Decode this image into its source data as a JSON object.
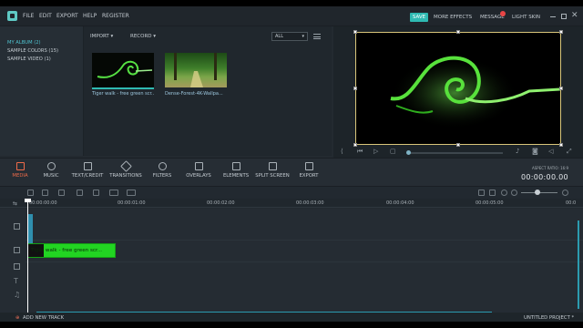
{
  "menu": {
    "items": [
      "FILE",
      "EDIT",
      "EXPORT",
      "HELP",
      "REGISTER"
    ],
    "save_label": "SAVE",
    "more_effects": "MORE EFFECTS",
    "message": "MESSAGE",
    "light_skin": "LIGHT SKIN",
    "badge_count": "3"
  },
  "library": {
    "albums": [
      "MY ALBUM (2)",
      "SAMPLE COLORS (15)",
      "SAMPLE VIDEO (1)"
    ],
    "import_label": "IMPORT ▾",
    "record_label": "RECORD ▾",
    "filter_value": "ALL",
    "media": [
      {
        "label": "Tiger walk - free green scr..."
      },
      {
        "label": "Dense-Forest-4K-Wallpa..."
      }
    ]
  },
  "toolbar": {
    "tools": [
      "MEDIA",
      "MUSIC",
      "TEXT/CREDIT",
      "TRANSITIONS",
      "FILTERS",
      "OVERLAYS",
      "ELEMENTS",
      "SPLIT SCREEN",
      "EXPORT"
    ],
    "active_tool": "MEDIA",
    "aspect_ratio": "ASPECT RATIO: 16:9",
    "timecode": "00:00:00.00"
  },
  "timeline": {
    "ruler": [
      "00:00:00:00",
      "00:00:01:00",
      "00:00:02:00",
      "00:00:03:00",
      "00:00:04:00",
      "00:00:05:00",
      "00:0"
    ],
    "clip_label": "Tiger walk - free green scr..."
  },
  "status": {
    "add_track": "ADD NEW TRACK",
    "project": "UNTITLED PROJECT *"
  },
  "colors": {
    "accent": "#2fbab2",
    "active_tool": "#f06b4a",
    "clip": "#22d422",
    "selection": "#d9c67a"
  }
}
